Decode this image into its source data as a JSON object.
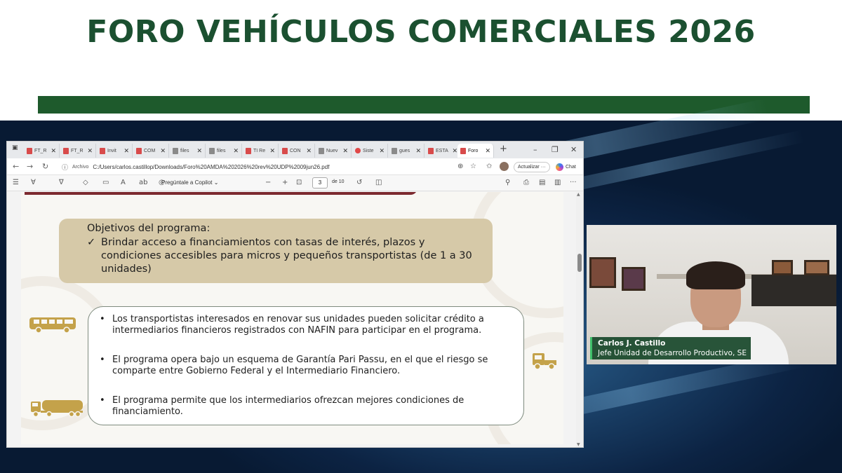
{
  "slide": {
    "title": "FORO VEHÍCULOS COMERCIALES 2026",
    "colors": {
      "title": "#1b5030",
      "rule": "#1e5a2c",
      "backdrop": "#0c2343"
    }
  },
  "browser": {
    "tabs": [
      "FT_R",
      "FT_R",
      "Invit",
      "COM",
      "files",
      "files",
      "TI Re",
      "CON",
      "Nuev",
      "Siste",
      "gues",
      "ESTA",
      "Foro"
    ],
    "active_tab_index": 12,
    "new_tab_label": "+",
    "window_controls": {
      "minimize": "–",
      "restore": "❐",
      "close": "✕"
    },
    "address": {
      "prefix": "Archivo",
      "url": "C:/Users/carlos.castillop/Downloads/Foro%20AMDA%202026%20rev%20UDP%2009jun26.pdf"
    },
    "update_button": "Actualizar",
    "update_menu": "···",
    "chat_button": "Chat",
    "pdf_toolbar": {
      "ask_copilot": "Pregúntale a Copilot",
      "zoom_out": "−",
      "zoom_in": "+",
      "current_page": "3",
      "total_pages": "de 10"
    }
  },
  "pdf": {
    "objetivos_title": "Objetivos del programa:",
    "objetivos_check": "✓",
    "objetivos_item": "Brindar acceso a financiamientos con tasas de interés, plazos y condiciones accesibles para micros y pequeños transportistas (de 1 a 30 unidades)",
    "bullet_symbol": "•",
    "bullets": [
      "Los transportistas interesados en renovar sus unidades pueden solicitar crédito a intermediarios financieros registrados con NAFIN para participar en el programa.",
      "El programa opera bajo un esquema de Garantía Pari Passu, en el que el riesgo se comparte entre Gobierno Federal y el Intermediario Financiero.",
      "El programa permite que los intermediarios ofrezcan mejores condiciones de financiamiento."
    ],
    "icon_color": "#c4a24a",
    "icons": [
      "bus-icon",
      "truck-icon",
      "tanker-truck-icon"
    ]
  },
  "webcam": {
    "name": "Carlos J. Castillo",
    "role": "Jefe Unidad de Desarrollo Productivo, SE"
  }
}
